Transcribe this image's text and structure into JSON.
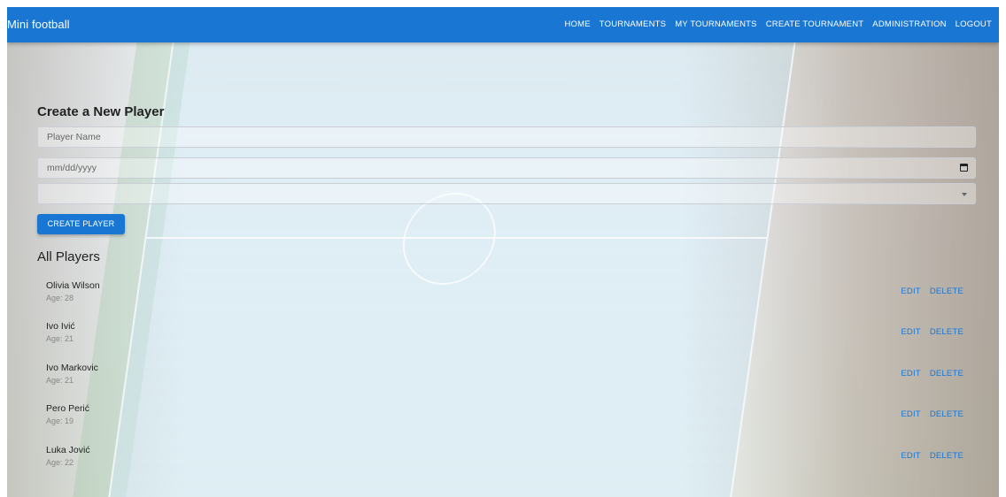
{
  "app": {
    "title": "Mini football",
    "nav": [
      "HOME",
      "TOURNAMENTS",
      "MY TOURNAMENTS",
      "CREATE TOURNAMENT",
      "ADMINISTRATION",
      "LOGOUT"
    ]
  },
  "form": {
    "heading": "Create a New Player",
    "name_placeholder": "Player Name",
    "date_placeholder": "mm/dd/yyyy",
    "select_value": "",
    "submit_label": "CREATE PLAYER"
  },
  "players": {
    "heading": "All Players",
    "edit_label": "EDIT",
    "delete_label": "DELETE",
    "items": [
      {
        "name": "Olivia Wilson",
        "age": "Age: 28"
      },
      {
        "name": "Ivo Ivić",
        "age": "Age: 21"
      },
      {
        "name": "Ivo Markovic",
        "age": "Age: 21"
      },
      {
        "name": "Pero Perić",
        "age": "Age: 19"
      },
      {
        "name": "Luka Jović",
        "age": "Age: 22"
      }
    ]
  },
  "colors": {
    "primary": "#1976d2",
    "text": "#222222",
    "muted": "#888888"
  },
  "icons": {
    "date_picker": "calendar-icon",
    "select": "dropdown-caret-icon"
  }
}
